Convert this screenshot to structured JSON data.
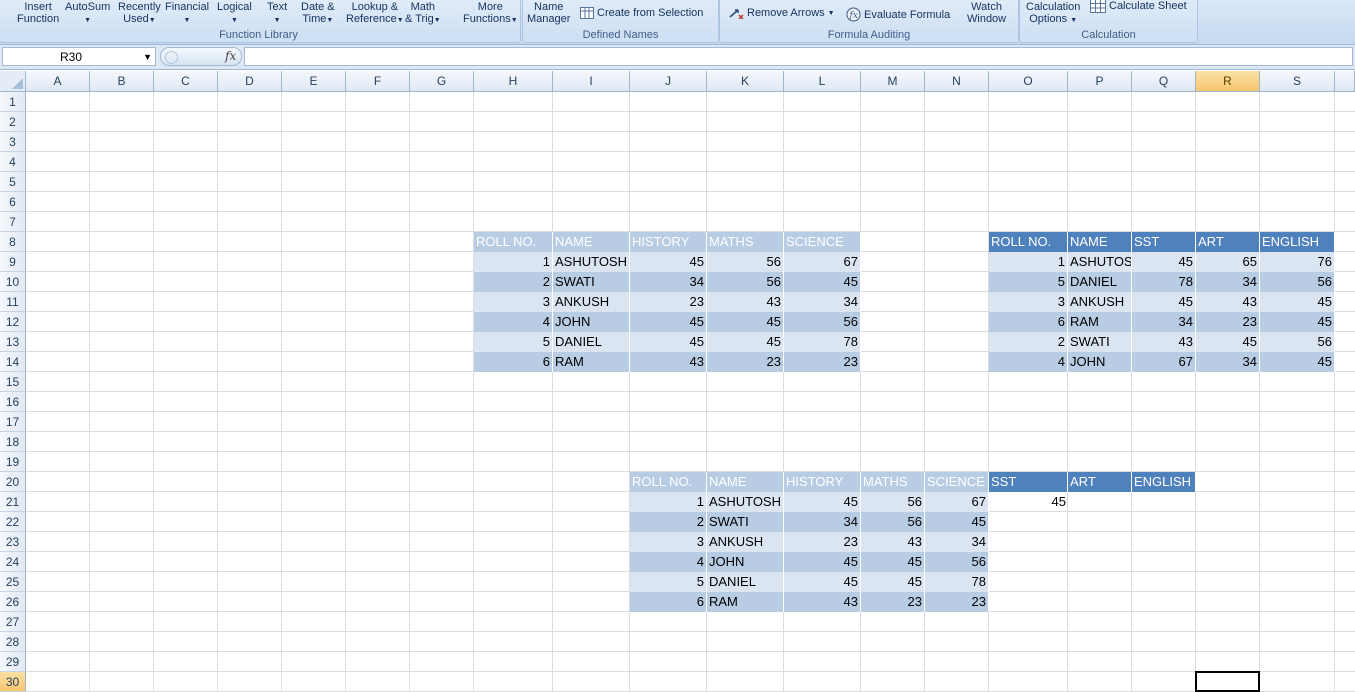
{
  "ribbon": {
    "function_library": {
      "label": "Function Library",
      "buttons": [
        {
          "id": "insert-function",
          "l1": "Insert",
          "l2": "Function",
          "drop": false
        },
        {
          "id": "autosum",
          "l1": "AutoSum",
          "l2": "",
          "drop": true
        },
        {
          "id": "recently-used",
          "l1": "Recently",
          "l2": "Used",
          "drop": true
        },
        {
          "id": "financial",
          "l1": "Financial",
          "l2": "",
          "drop": true
        },
        {
          "id": "logical",
          "l1": "Logical",
          "l2": "",
          "drop": true
        },
        {
          "id": "text",
          "l1": "Text",
          "l2": "",
          "drop": true
        },
        {
          "id": "date-time",
          "l1": "Date &",
          "l2": "Time",
          "drop": true
        },
        {
          "id": "lookup-reference",
          "l1": "Lookup &",
          "l2": "Reference",
          "drop": true
        },
        {
          "id": "math-trig",
          "l1": "Math",
          "l2": "& Trig",
          "drop": true
        },
        {
          "id": "more-functions",
          "l1": "More",
          "l2": "Functions",
          "drop": true
        }
      ]
    },
    "defined_names": {
      "label": "Defined Names",
      "name_manager": {
        "l1": "Name",
        "l2": "Manager"
      },
      "create_from_selection": "Create from Selection"
    },
    "formula_auditing": {
      "label": "Formula Auditing",
      "remove_arrows": "Remove Arrows",
      "evaluate_formula": "Evaluate Formula",
      "watch_window": {
        "l1": "Watch",
        "l2": "Window"
      }
    },
    "calculation": {
      "label": "Calculation",
      "calculation_options": {
        "l1": "Calculation",
        "l2": "Options"
      },
      "calculate_sheet": "Calculate Sheet"
    }
  },
  "formula_bar": {
    "name_box": "R30",
    "fx_label": "fx",
    "formula": ""
  },
  "sheet": {
    "columns": [
      "A",
      "B",
      "C",
      "D",
      "E",
      "F",
      "G",
      "H",
      "I",
      "J",
      "K",
      "L",
      "M",
      "N",
      "O",
      "P",
      "Q",
      "R",
      "S"
    ],
    "rows": [
      "1",
      "2",
      "3",
      "4",
      "5",
      "6",
      "7",
      "8",
      "9",
      "10",
      "11",
      "12",
      "13",
      "14",
      "15",
      "16",
      "17",
      "18",
      "19",
      "20",
      "21",
      "22",
      "23",
      "24",
      "25",
      "26",
      "27",
      "28",
      "29",
      "30"
    ],
    "selected_column": "R",
    "selected_row": "30",
    "table1": {
      "headers": [
        "ROLL NO.",
        "NAME",
        "HISTORY",
        "MATHS",
        "SCIENCE"
      ],
      "rows": [
        [
          "1",
          "ASHUTOSH",
          "45",
          "56",
          "67"
        ],
        [
          "2",
          "SWATI",
          "34",
          "56",
          "45"
        ],
        [
          "3",
          "ANKUSH",
          "23",
          "43",
          "34"
        ],
        [
          "4",
          "JOHN",
          "45",
          "45",
          "56"
        ],
        [
          "5",
          "DANIEL",
          "45",
          "45",
          "78"
        ],
        [
          "6",
          "RAM",
          "43",
          "23",
          "23"
        ]
      ]
    },
    "table2": {
      "headers": [
        "ROLL NO.",
        "NAME",
        "SST",
        "ART",
        "ENGLISH"
      ],
      "rows": [
        [
          "1",
          "ASHUTOSH",
          "45",
          "65",
          "76"
        ],
        [
          "5",
          "DANIEL",
          "78",
          "34",
          "56"
        ],
        [
          "3",
          "ANKUSH",
          "45",
          "43",
          "45"
        ],
        [
          "6",
          "RAM",
          "34",
          "23",
          "45"
        ],
        [
          "2",
          "SWATI",
          "43",
          "45",
          "56"
        ],
        [
          "4",
          "JOHN",
          "67",
          "34",
          "45"
        ]
      ]
    },
    "table3": {
      "headers": [
        "ROLL NO.",
        "NAME",
        "HISTORY",
        "MATHS",
        "SCIENCE",
        "SST",
        "ART",
        "ENGLISH"
      ],
      "rows": [
        [
          "1",
          "ASHUTOSH",
          "45",
          "56",
          "67",
          "45"
        ],
        [
          "2",
          "SWATI",
          "34",
          "56",
          "45"
        ],
        [
          "3",
          "ANKUSH",
          "23",
          "43",
          "34"
        ],
        [
          "4",
          "JOHN",
          "45",
          "45",
          "56"
        ],
        [
          "5",
          "DANIEL",
          "45",
          "45",
          "78"
        ],
        [
          "6",
          "RAM",
          "43",
          "23",
          "23"
        ]
      ]
    }
  }
}
